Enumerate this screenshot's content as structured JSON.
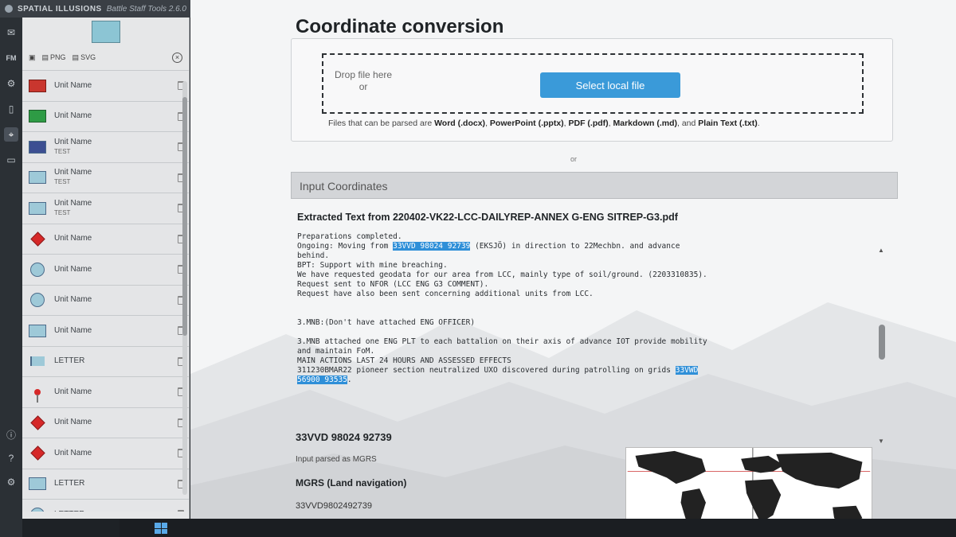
{
  "app": {
    "brand": "SPATIAL ILLUSIONS",
    "subtitle": "Battle Staff Tools 2.6.0"
  },
  "rail": {
    "icons": [
      "mail-icon",
      "fm-icon",
      "network-icon",
      "map-icon",
      "crosshair-icon",
      "book-icon"
    ],
    "fm_label": "FM",
    "bottom_icons": [
      "info-icon",
      "help-icon",
      "settings-icon"
    ]
  },
  "panel": {
    "toolbar": {
      "png_label": "PNG",
      "svg_label": "SVG"
    },
    "units": [
      {
        "name": "Unit Name",
        "sub": "",
        "symbol": "flag-red"
      },
      {
        "name": "Unit Name",
        "sub": "",
        "symbol": "flag-brazil"
      },
      {
        "name": "Unit Name",
        "sub": "TEST",
        "symbol": "box-blue"
      },
      {
        "name": "Unit Name",
        "sub": "TEST",
        "symbol": "box"
      },
      {
        "name": "Unit Name",
        "sub": "TEST",
        "symbol": "box"
      },
      {
        "name": "Unit Name",
        "sub": "",
        "symbol": "diamond"
      },
      {
        "name": "Unit Name",
        "sub": "",
        "symbol": "circle"
      },
      {
        "name": "Unit Name",
        "sub": "",
        "symbol": "circle"
      },
      {
        "name": "Unit Name",
        "sub": "",
        "symbol": "box"
      },
      {
        "name": "LETTER",
        "sub": "",
        "symbol": "flag"
      },
      {
        "name": "Unit Name",
        "sub": "",
        "symbol": "pin"
      },
      {
        "name": "Unit Name",
        "sub": "",
        "symbol": "diamond"
      },
      {
        "name": "Unit Name",
        "sub": "",
        "symbol": "diamond"
      },
      {
        "name": "LETTER",
        "sub": "",
        "symbol": "box"
      },
      {
        "name": "LETTER",
        "sub": "",
        "symbol": "circle"
      }
    ]
  },
  "main": {
    "title": "Coordinate conversion",
    "drop": {
      "text_line1": "Drop file here",
      "text_line2": "or",
      "button": "Select local file",
      "types_prefix": "Files that can be parsed are ",
      "types": [
        "Word (.docx)",
        "PowerPoint (.pptx)",
        "PDF (.pdf)",
        "Markdown (.md)",
        "Plain Text (.txt)"
      ]
    },
    "or_label": "or",
    "input_header": "Input Coordinates",
    "extracted_title": "Extracted Text from 220402-VK22-LCC-DAILYREP-ANNEX G-ENG SITREP-G3.pdf",
    "lines": [
      {
        "pre": "Preparations completed.",
        "hl": "",
        "post": ""
      },
      {
        "pre": "Ongoing: Moving from ",
        "hl": "33VVD 98024 92739",
        "post": " (EKSJÖ) in direction to 22Mechbn. and advance"
      },
      {
        "pre": "behind.",
        "hl": "",
        "post": ""
      },
      {
        "pre": "BPT: Support with mine breaching.",
        "hl": "",
        "post": ""
      },
      {
        "pre": "We have requested geodata for our area from LCC, mainly type of soil/ground. (2203310835).",
        "hl": "",
        "post": ""
      },
      {
        "pre": "Request sent to NFOR (LCC ENG G3 COMMENT).",
        "hl": "",
        "post": ""
      },
      {
        "pre": "Request have also been sent concerning additional units from LCC.",
        "hl": "",
        "post": ""
      },
      {
        "pre": "",
        "hl": "",
        "post": ""
      },
      {
        "pre": "",
        "hl": "",
        "post": ""
      },
      {
        "pre": "3.MNB:(Don't have attached ENG OFFICER)",
        "hl": "",
        "post": ""
      },
      {
        "pre": "",
        "hl": "",
        "post": ""
      },
      {
        "pre": "3.MNB attached one ENG PLT to each battalion on their axis of advance IOT provide mobility",
        "hl": "",
        "post": ""
      },
      {
        "pre": "and maintain FoM.",
        "hl": "",
        "post": ""
      },
      {
        "pre": "MAIN ACTIONS LAST 24 HOURS AND ASSESSED EFFECTS",
        "hl": "",
        "post": ""
      },
      {
        "pre": "311230BMAR22 pioneer section neutralized UXO discovered during patrolling on grids ",
        "hl": "33VWD",
        "post": ""
      },
      {
        "pre": "",
        "hl": "56900 93535",
        "post": "."
      }
    ],
    "result": {
      "coord": "33VVD 98024 92739",
      "parsed": "Input parsed as MGRS",
      "mgrs_title": "MGRS (Land navigation)",
      "mgrs_value": "33VVD9802492739"
    }
  }
}
